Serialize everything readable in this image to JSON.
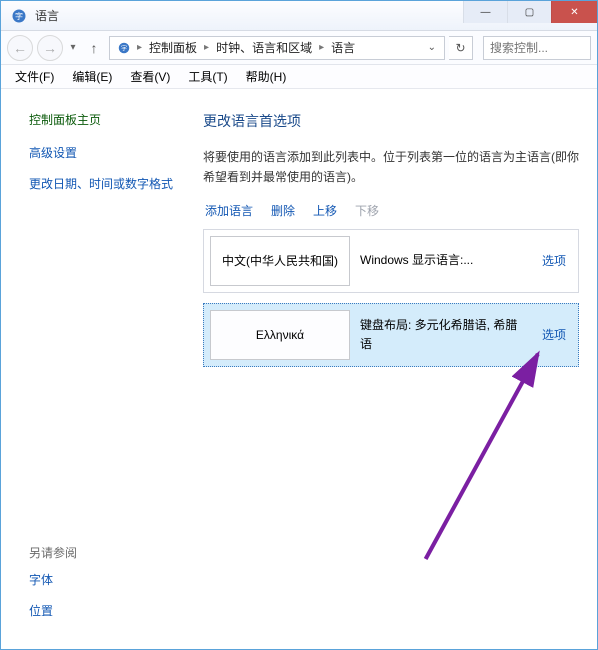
{
  "window": {
    "title": "语言",
    "controls": {
      "min": "—",
      "max": "▢",
      "close": "✕"
    }
  },
  "addressbar": {
    "back": "←",
    "forward": "→",
    "up": "↑",
    "breadcrumbs": [
      "控制面板",
      "时钟、语言和区域",
      "语言"
    ],
    "refresh": "↻",
    "search_placeholder": "搜索控制..."
  },
  "menu": {
    "file": "文件(F)",
    "edit": "编辑(E)",
    "view": "查看(V)",
    "tools": "工具(T)",
    "help": "帮助(H)"
  },
  "sidebar": {
    "home": "控制面板主页",
    "links": [
      "高级设置",
      "更改日期、时间或数字格式"
    ],
    "see_also_heading": "另请参阅",
    "see_also": [
      "字体",
      "位置"
    ]
  },
  "main": {
    "heading": "更改语言首选项",
    "description": "将要使用的语言添加到此列表中。位于列表第一位的语言为主语言(即你希望看到并最常使用的语言)。",
    "toolbar": {
      "add": "添加语言",
      "remove": "删除",
      "up": "上移",
      "down": "下移"
    },
    "languages": [
      {
        "name": "中文(中华人民共和国)",
        "info": "Windows 显示语言:...",
        "options_label": "选项",
        "selected": false
      },
      {
        "name": "Ελληνικά",
        "info": "键盘布局: 多元化希腊语, 希腊语",
        "options_label": "选项",
        "selected": true
      }
    ]
  }
}
